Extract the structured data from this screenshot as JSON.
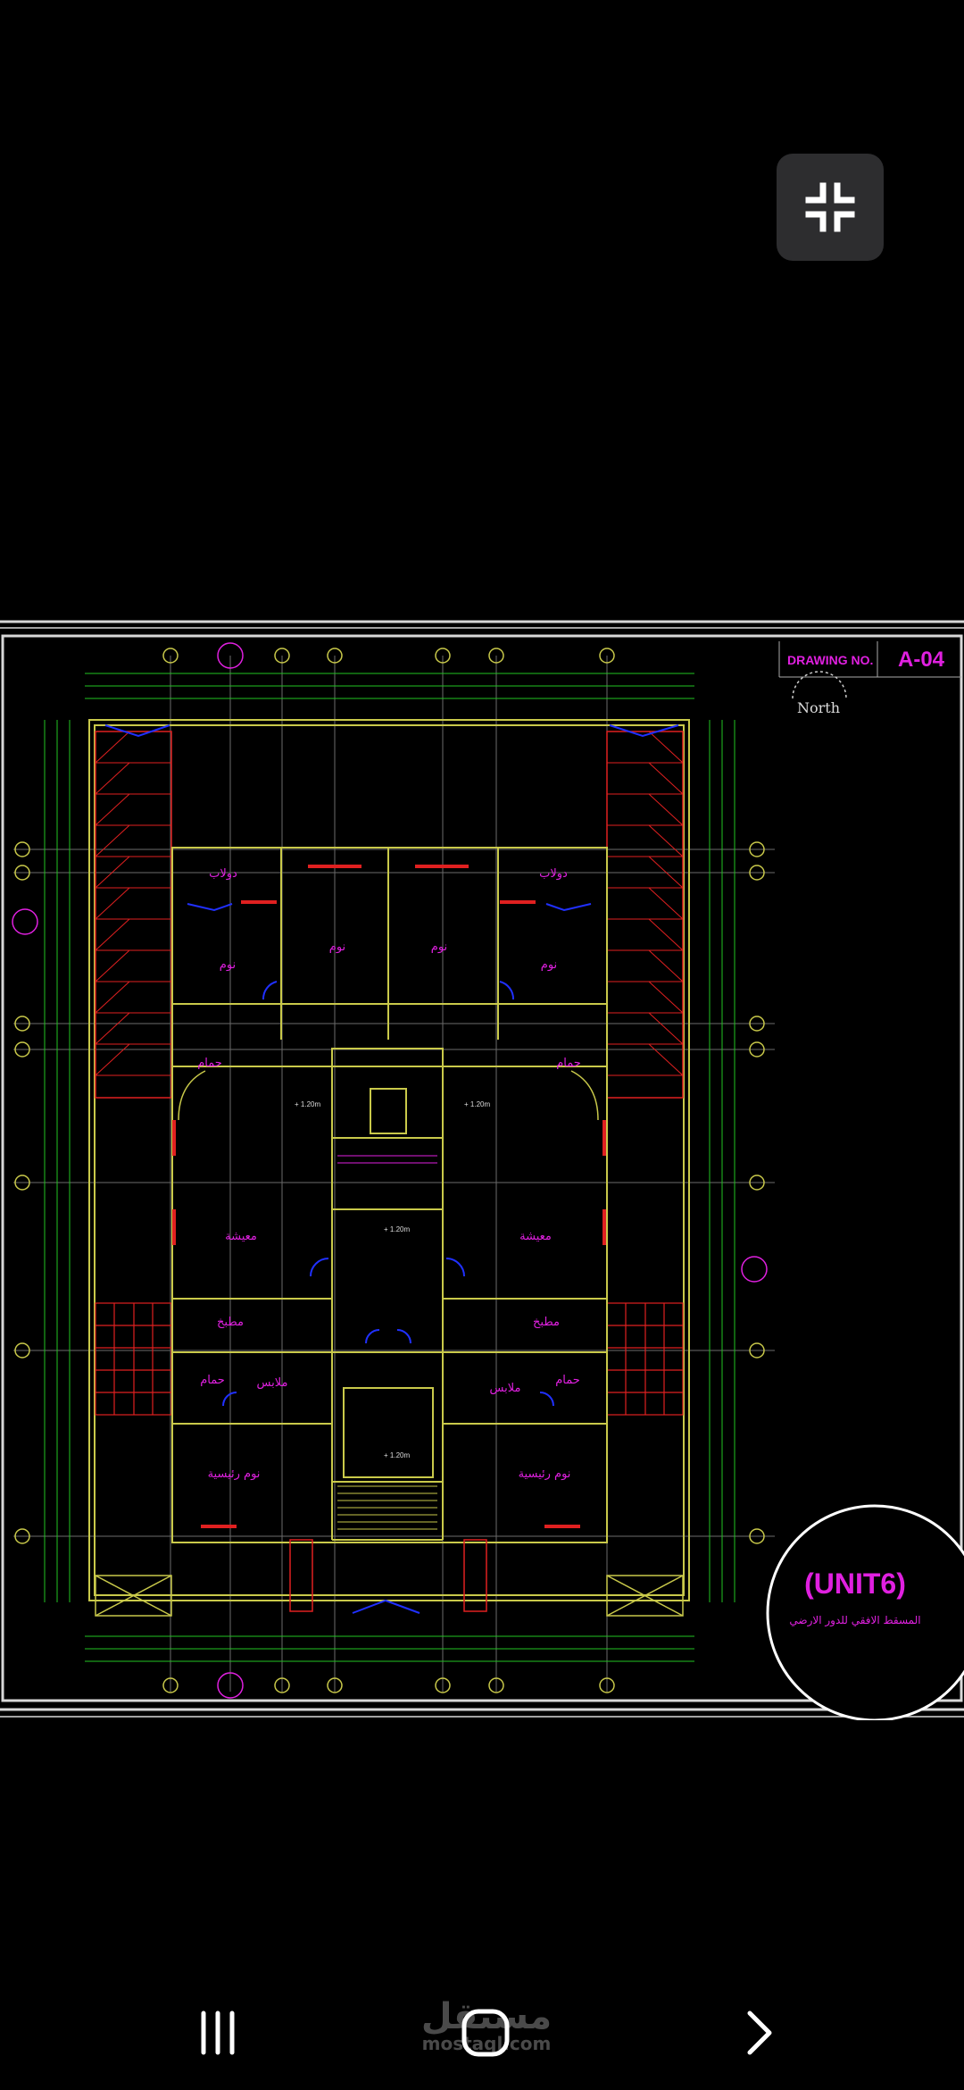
{
  "toolbar": {
    "exit_fullscreen_icon": "exit-fullscreen-icon"
  },
  "drawing": {
    "label_drawing_no": "DRAWING NO.",
    "drawing_no": "A-04",
    "north": "North",
    "unit": "(UNIT6)",
    "plan_title": "المسقط الافقي للدور الارضي",
    "rooms": {
      "living_left": "معيشة",
      "living_right": "معيشة",
      "bed_top_left": "نوم",
      "bed_top_mid_left": "نوم",
      "bed_top_mid_right": "نوم",
      "bed_top_right": "نوم",
      "dress_top_left": "دولاب",
      "dress_top_right": "دولاب",
      "bath_left": "حمام",
      "bath_right": "حمام",
      "kitchen_left": "مطبخ",
      "kitchen_right": "مطبخ",
      "bath_low_left": "حمام",
      "bath_low_right": "حمام",
      "clothes_left": "ملابس",
      "clothes_right": "ملابس",
      "master_left": "نوم رئيسية",
      "master_right": "نوم رئيسية"
    },
    "levels": {
      "stair": "+ 1.20m",
      "left": "+ 1.20m",
      "right": "+ 1.20m",
      "core": "+ 1.20m"
    },
    "colors": {
      "wall": "#c9c94a",
      "grid": "#6b6b6b",
      "magenta": "#e020e0",
      "dim": "#22c322",
      "red": "#e02020",
      "blue": "#2030ff"
    }
  },
  "watermark": {
    "arabic": "مستقل",
    "latin": "mostaql.com"
  },
  "navbar": {
    "recents_icon": "recents-icon",
    "home_icon": "home-icon",
    "back_icon": "back-icon"
  }
}
